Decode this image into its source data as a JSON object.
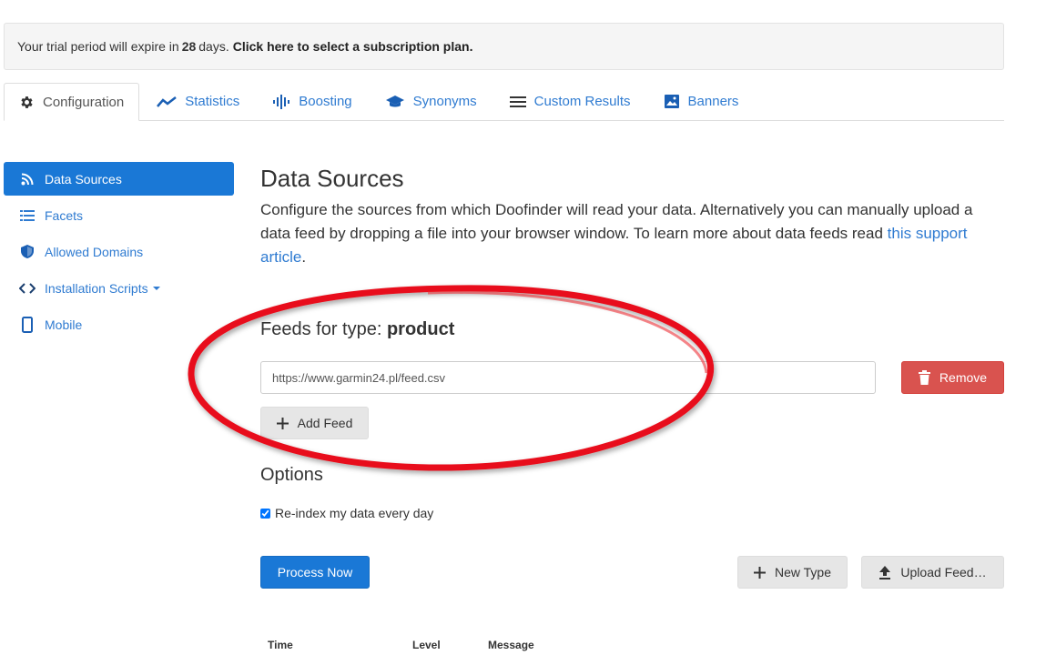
{
  "trial": {
    "prefix": "Your trial period will expire in",
    "days": "28",
    "suffix": "days.",
    "link": "Click here to select a subscription plan."
  },
  "tabs": [
    {
      "label": "Configuration",
      "icon": "gear-icon",
      "active": true
    },
    {
      "label": "Statistics",
      "icon": "line-chart-icon"
    },
    {
      "label": "Boosting",
      "icon": "soundwave-icon"
    },
    {
      "label": "Synonyms",
      "icon": "graduation-cap-icon"
    },
    {
      "label": "Custom Results",
      "icon": "list-icon"
    },
    {
      "label": "Banners",
      "icon": "image-icon"
    }
  ],
  "sidebar": {
    "items": [
      {
        "label": "Data Sources",
        "icon": "rss-icon",
        "active": true
      },
      {
        "label": "Facets",
        "icon": "list-icon"
      },
      {
        "label": "Allowed Domains",
        "icon": "shield-icon"
      },
      {
        "label": "Installation Scripts",
        "icon": "code-icon"
      },
      {
        "label": "Mobile",
        "icon": "mobile-icon"
      }
    ]
  },
  "main": {
    "title": "Data Sources",
    "intro_text": "Configure the sources from which Doofinder will read your data. Alternatively you can manually upload a data feed by dropping a file into your browser window. To learn more about data feeds read",
    "intro_link": "this support article",
    "intro_end": "."
  },
  "feeds": {
    "heading_prefix": "Feeds for type:",
    "type": "product",
    "url": "https://www.garmin24.pl/feed.csv",
    "remove_label": "Remove",
    "add_label": "Add Feed"
  },
  "options": {
    "heading": "Options",
    "reindex_label": "Re-index my data every day",
    "reindex_checked": true
  },
  "actions": {
    "process_label": "Process Now",
    "new_type_label": "New Type",
    "upload_label": "Upload Feed…"
  },
  "log": {
    "columns": [
      "Time",
      "Level",
      "Message"
    ]
  },
  "colors": {
    "primary": "#1a78d6",
    "link": "#2f7bd1",
    "danger": "#d9534f",
    "annotation": "#e8101a"
  }
}
